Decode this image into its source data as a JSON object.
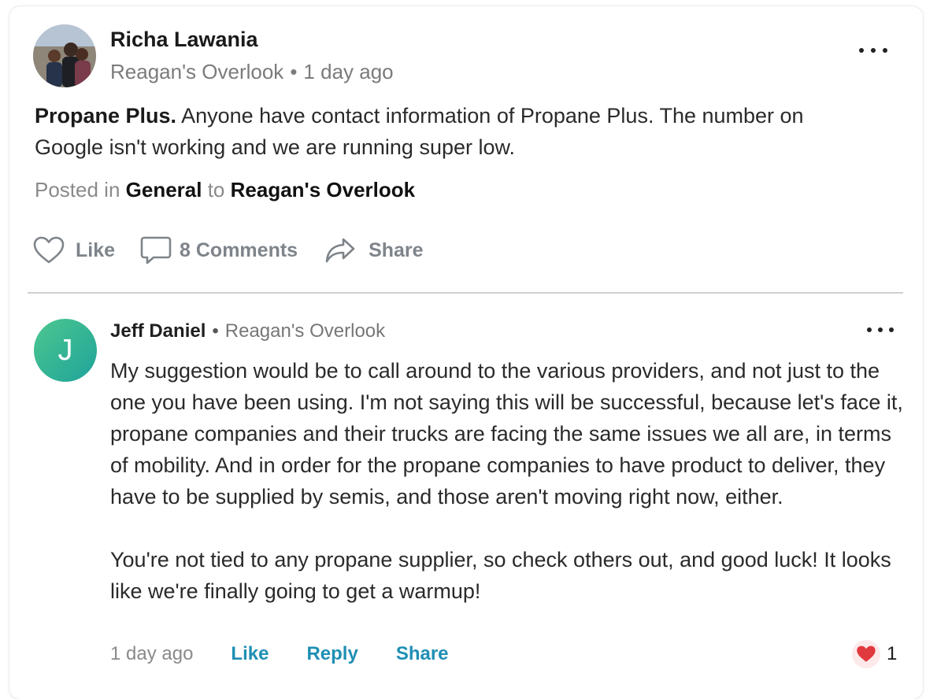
{
  "post": {
    "author": "Richa Lawania",
    "group": "Reagan's Overlook",
    "separator": "•",
    "time": "1 day ago",
    "title": "Propane Plus.",
    "body": "Anyone have contact information of Propane Plus. The number on Google isn't working and we are running super low.",
    "posted_in_label": "Posted in",
    "category": "General",
    "to_label": "to",
    "destination": "Reagan's Overlook",
    "actions": {
      "like": "Like",
      "comments": "8 Comments",
      "share": "Share"
    }
  },
  "comment": {
    "avatar_initial": "J",
    "author": "Jeff Daniel",
    "separator": "•",
    "group": "Reagan's Overlook",
    "paragraph1": "My suggestion would be to call around to the various providers, and not just to the one you have been using. I'm not saying this will be successful, because let's face it, propane companies and their trucks are facing the same issues we all are, in terms of mobility. And in order for the propane companies to have product to deliver, they have to be supplied by semis, and those aren't moving right now, either.",
    "paragraph2": "You're not tied to any propane supplier, so check others out, and good luck! It looks like we're finally going to get a warmup!",
    "time": "1 day ago",
    "like": "Like",
    "reply": "Reply",
    "share": "Share",
    "reaction_count": "1"
  },
  "icons": {
    "post_menu": "more-horizontal-icon",
    "like": "heart-outline-icon",
    "comments": "comment-bubble-icon",
    "share": "share-arrow-icon",
    "reaction": "heart-filled-icon"
  },
  "colors": {
    "link": "#1f8fb4",
    "muted": "#7e848a",
    "avatar_gradient_start": "#4dc78f",
    "avatar_gradient_end": "#1ea39a",
    "reaction_heart": "#e0393e"
  }
}
